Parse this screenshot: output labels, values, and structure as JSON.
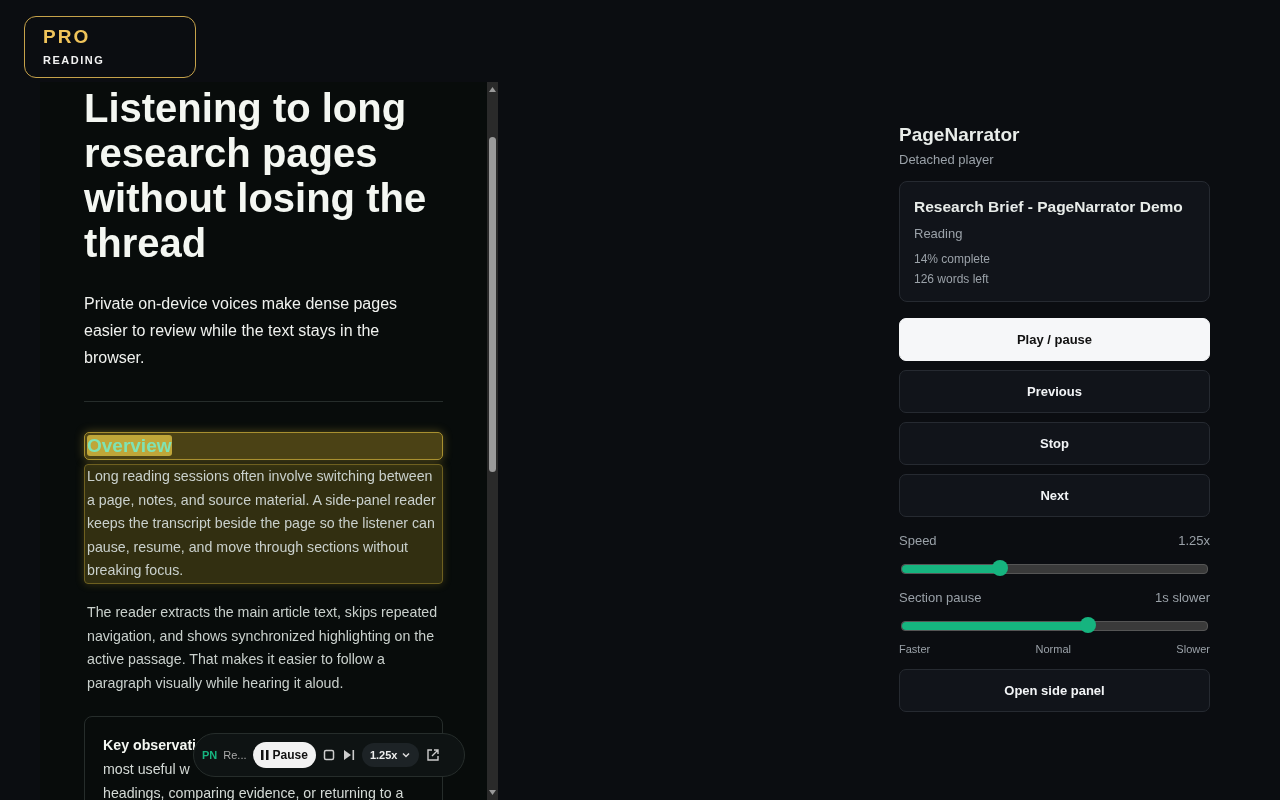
{
  "badge": {
    "title": "PRO",
    "subtitle": "READING"
  },
  "article": {
    "title": "Listening to long research pages without losing the thread",
    "lead": "Private on-device voices make dense pages easier to review while the text stays in the browser.",
    "sections": [
      {
        "heading": "Overview",
        "highlighted": true,
        "paragraphs": [
          {
            "text": "Long reading sessions often involve switching between a page, notes, and source material. A side-panel reader keeps the transcript beside the page so the listener can pause, resume, and move through sections without breaking focus.",
            "highlighted": true
          },
          {
            "text": "The reader extracts the main article text, skips repeated navigation, and shows synchronized highlighting on the active passage. That makes it easier to follow a paragraph visually while hearing it aloud.",
            "highlighted": false
          }
        ]
      }
    ],
    "callout": {
      "lines": [
        "**Key observati**",
        "most useful w",
        "headings, comparing evidence, or returning to a"
      ]
    }
  },
  "mini_player": {
    "logo": "PN",
    "title": "Re...",
    "pause_button": "Pause",
    "speed": "1.25x"
  },
  "player": {
    "title": "PageNarrator",
    "subtitle": "Detached player",
    "now_playing": {
      "title": "Research Brief - PageNarrator Demo",
      "status": "Reading",
      "progress": "14% complete",
      "remaining": "126 words left"
    },
    "buttons": [
      {
        "label": "Play / pause",
        "primary": true
      },
      {
        "label": "Previous",
        "primary": false
      },
      {
        "label": "Stop",
        "primary": false
      },
      {
        "label": "Next",
        "primary": false
      }
    ],
    "sliders": [
      {
        "label": "Speed",
        "reading": "1.25x",
        "level": 0.32
      },
      {
        "label": "Section pause",
        "reading": "1s slower",
        "level": 0.61,
        "scale": [
          "Faster",
          "Normal",
          "Slower"
        ]
      }
    ],
    "footer_button": "Open side panel"
  }
}
